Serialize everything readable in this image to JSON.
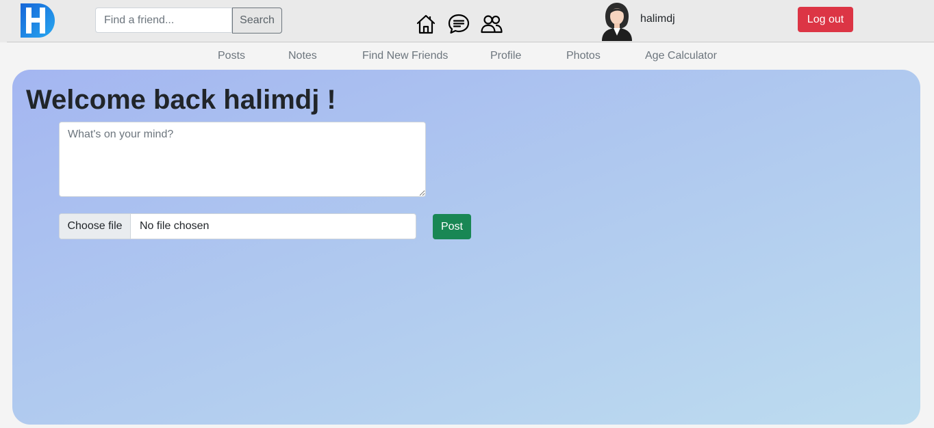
{
  "header": {
    "logo_icon": "hd-logo-icon",
    "search": {
      "placeholder": "Find a friend...",
      "value": "",
      "button_label": "Search"
    },
    "icons": [
      "home-icon",
      "chat-icon",
      "friends-icon"
    ],
    "user": {
      "avatar_icon": "avatar-icon",
      "username": "halimdj"
    },
    "logout_label": "Log out"
  },
  "nav": {
    "items": [
      {
        "label": "Posts"
      },
      {
        "label": "Notes"
      },
      {
        "label": "Find New Friends"
      },
      {
        "label": "Profile"
      },
      {
        "label": "Photos"
      },
      {
        "label": "Age Calculator"
      }
    ]
  },
  "main": {
    "welcome_title": "Welcome back halimdj !",
    "post_box": {
      "placeholder": "What's on your mind?",
      "value": ""
    },
    "file_input": {
      "button_label": "Choose file",
      "status": "No file chosen"
    },
    "post_label": "Post"
  },
  "colors": {
    "logout": "#dc3545",
    "post": "#198754",
    "logo": "#1e7be0",
    "panel_gradient_start": "#a4b6f1",
    "panel_gradient_end": "#bddcef"
  }
}
